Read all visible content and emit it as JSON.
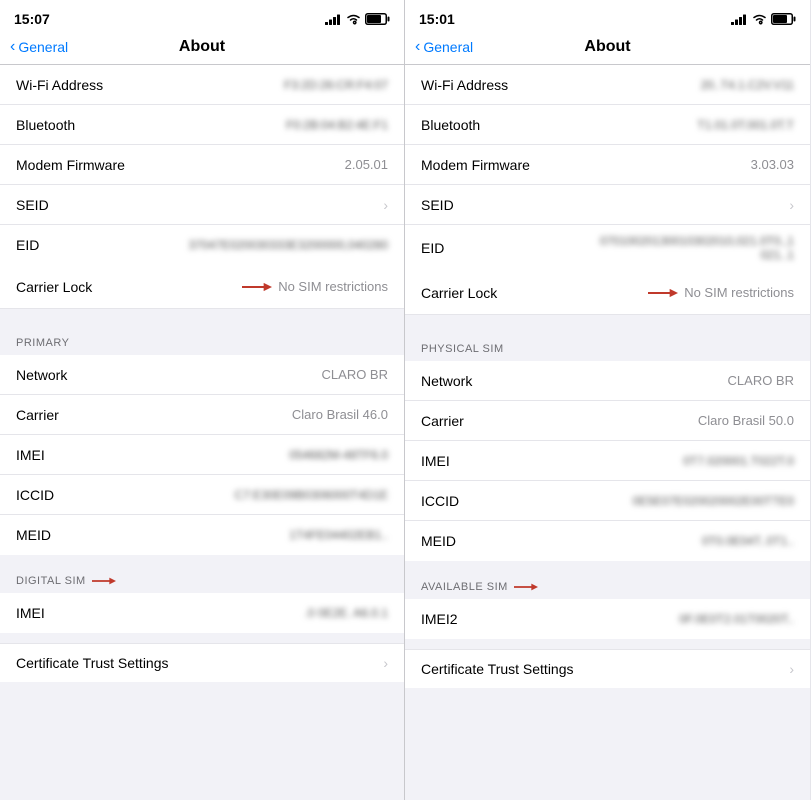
{
  "panels": [
    {
      "id": "left",
      "status": {
        "time": "15:07",
        "signal": [
          3,
          5,
          7,
          9,
          11
        ],
        "wifi": "wifi",
        "battery": 80
      },
      "nav": {
        "back_label": "General",
        "title": "About"
      },
      "rows_top": [
        {
          "label": "Wi-Fi Address",
          "value": "blurred",
          "value_text": "F3:2D:26:CR:F4:07"
        },
        {
          "label": "Bluetooth",
          "value": "blurred",
          "value_text": "F0:2B:04:B2:4E:F1"
        },
        {
          "label": "Modem Firmware",
          "value": "2.05.01",
          "value_text": "2.05.01"
        },
        {
          "label": "SEID",
          "value": "chevron"
        },
        {
          "label": "EID",
          "value": "blurred",
          "value_text": "37047E020030333E3200000,040280"
        }
      ],
      "carrier_lock": {
        "label": "Carrier Lock",
        "value": "No SIM restrictions"
      },
      "section_primary": {
        "label": "PRIMARY"
      },
      "rows_primary": [
        {
          "label": "Network",
          "value": "CLARO BR"
        },
        {
          "label": "Carrier",
          "value": "Claro Brasil 46.0"
        },
        {
          "label": "IMEI",
          "value": "blurred",
          "value_text": "054682M-48TF6.0"
        },
        {
          "label": "ICCID",
          "value": "blurred",
          "value_text": "C7:E30E09B0306000T4D1E"
        },
        {
          "label": "MEID",
          "value": "blurred",
          "value_text": "1T4FE04402EB1.."
        }
      ],
      "section_digital": {
        "label": "DIGITAL SIM",
        "has_arrow": true
      },
      "rows_digital": [
        {
          "label": "IMEI",
          "value": "blurred",
          "value_text": ".0 0E2E. A6.0.1"
        }
      ],
      "cert": {
        "label": "Certificate Trust Settings"
      }
    },
    {
      "id": "right",
      "status": {
        "time": "15:01",
        "signal": [
          3,
          5,
          7,
          9,
          11
        ],
        "wifi": "wifi",
        "battery": 80
      },
      "nav": {
        "back_label": "General",
        "title": "About"
      },
      "rows_top": [
        {
          "label": "Wi-Fi Address",
          "value": "blurred",
          "value_text": "20..T4.1.C2V.V11"
        },
        {
          "label": "Bluetooth",
          "value": "blurred",
          "value_text": "T1.01.0T.001.0T.T"
        },
        {
          "label": "Modem Firmware",
          "value": "3.03.03",
          "value_text": "3.03.03"
        },
        {
          "label": "SEID",
          "value": "chevron"
        },
        {
          "label": "EID",
          "value": "blurred",
          "value_text": "07010020130010302010,021.0T0.,1021..1"
        }
      ],
      "carrier_lock": {
        "label": "Carrier Lock",
        "value": "No SIM restrictions"
      },
      "section_primary": {
        "label": "PHYSICAL SIM"
      },
      "rows_primary": [
        {
          "label": "Network",
          "value": "CLARO BR"
        },
        {
          "label": "Carrier",
          "value": "Claro Brasil 50.0"
        },
        {
          "label": "IMEI",
          "value": "blurred",
          "value_text": "0T7.020001.T022T.0"
        },
        {
          "label": "ICCID",
          "value": "blurred",
          "value_text": "0E5E07E020020002E00TTE0"
        },
        {
          "label": "MEID",
          "value": "blurred",
          "value_text": "0T0.0E04T..0T1.."
        }
      ],
      "section_digital": {
        "label": "AVAILABLE SIM",
        "has_arrow": true
      },
      "rows_digital": [
        {
          "label": "IMEI2",
          "value": "blurred",
          "value_text": "0F.0E0T2.01T0020T.."
        }
      ],
      "cert": {
        "label": "Certificate Trust Settings"
      }
    }
  ]
}
